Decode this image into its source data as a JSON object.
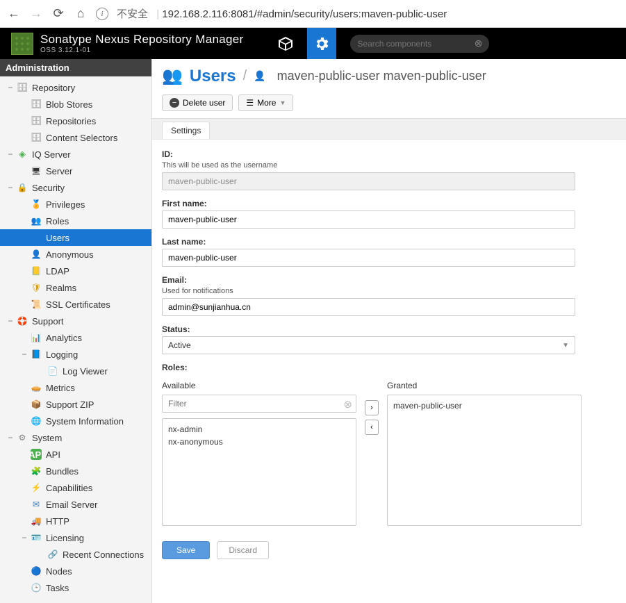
{
  "browser": {
    "unsafe_label": "不安全",
    "url": "192.168.2.116:8081/#admin/security/users:maven-public-user"
  },
  "header": {
    "title": "Sonatype Nexus Repository Manager",
    "subtitle": "OSS 3.12.1-01",
    "search_placeholder": "Search components"
  },
  "sidebar": {
    "title": "Administration",
    "nodes": {
      "repository": "Repository",
      "blob_stores": "Blob Stores",
      "repositories": "Repositories",
      "content_selectors": "Content Selectors",
      "iq_server": "IQ Server",
      "server": "Server",
      "security": "Security",
      "privileges": "Privileges",
      "roles": "Roles",
      "users": "Users",
      "anonymous": "Anonymous",
      "ldap": "LDAP",
      "realms": "Realms",
      "ssl_certificates": "SSL Certificates",
      "support": "Support",
      "analytics": "Analytics",
      "logging": "Logging",
      "log_viewer": "Log Viewer",
      "metrics": "Metrics",
      "support_zip": "Support ZIP",
      "system_information": "System Information",
      "system": "System",
      "api": "API",
      "bundles": "Bundles",
      "capabilities": "Capabilities",
      "email_server": "Email Server",
      "http": "HTTP",
      "licensing": "Licensing",
      "recent_connections": "Recent Connections",
      "nodes": "Nodes",
      "tasks": "Tasks"
    }
  },
  "breadcrumb": {
    "section": "Users",
    "user_display": "maven-public-user maven-public-user"
  },
  "toolbar": {
    "delete_label": "Delete user",
    "more_label": "More"
  },
  "tabs": {
    "settings": "Settings"
  },
  "form": {
    "id_label": "ID:",
    "id_help": "This will be used as the username",
    "id_value": "maven-public-user",
    "first_name_label": "First name:",
    "first_name_value": "maven-public-user",
    "last_name_label": "Last name:",
    "last_name_value": "maven-public-user",
    "email_label": "Email:",
    "email_help": "Used for notifications",
    "email_value": "admin@sunjianhua.cn",
    "status_label": "Status:",
    "status_value": "Active",
    "roles_label": "Roles:",
    "available_label": "Available",
    "granted_label": "Granted",
    "filter_placeholder": "Filter",
    "available_roles": [
      "nx-admin",
      "nx-anonymous"
    ],
    "granted_roles": [
      "maven-public-user"
    ],
    "save_label": "Save",
    "discard_label": "Discard"
  }
}
